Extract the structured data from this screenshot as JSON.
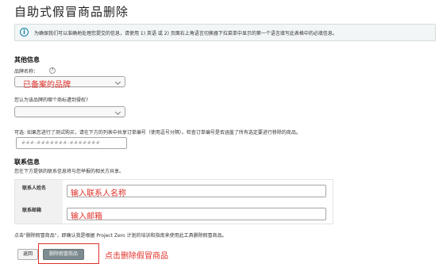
{
  "page": {
    "title": "自助式假冒商品删除"
  },
  "notice": {
    "icon": "info-icon",
    "text": "为确保我们可以准确地处理您提交的信息，请使用 1) 英语 或 2) 页面右上角语言切换器下拉菜单中显示的第一个语言填写此表格中的必填信息。"
  },
  "other_info": {
    "heading": "其他信息",
    "brand_label": "品牌名称：",
    "help_glyph": "?",
    "brand_value": "已备案的品牌",
    "auth_question": "您认为该品牌的哪个商标遭到侵权?",
    "test_buy_text": "可选: 如果您进行了测试购买，请在下方的列表中共享订单编号（使用逗号分隔）。检查订单编号是否涵盖了所有选定要进行移除的商品。",
    "order_placeholder": "###-#######-#######"
  },
  "contact": {
    "heading": "联系信息",
    "subtitle": "您在下方提供的联系信息将与您举报的相关方共享。",
    "name_label": "联系人姓名",
    "name_value": "输入联系人名称",
    "email_label": "联系邮箱",
    "email_value": "输入邮箱"
  },
  "footer": {
    "consent_text": "点击\"删除假冒商品\"，即确认我是根据 Project Zero 计划的培训和指南来使用此工具删除假冒商品。",
    "back_label": "返回",
    "delete_label": "删除假冒商品",
    "delete_annotation": "点击删除假冒商品"
  },
  "colors": {
    "annotation_red": "#e0302a",
    "info_blue": "#0a7ea6",
    "primary_button": "#7d8c91"
  }
}
